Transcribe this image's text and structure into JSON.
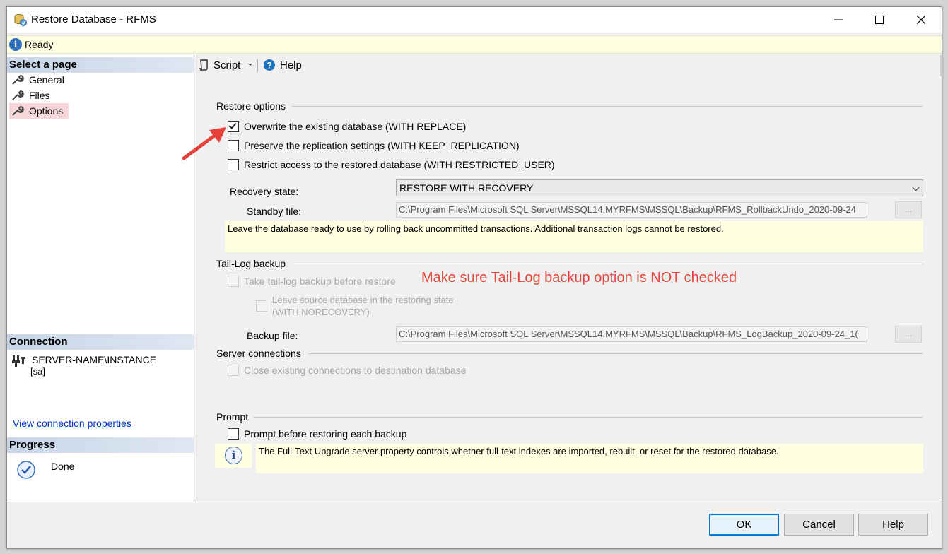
{
  "window": {
    "title": "Restore Database - RFMS",
    "status": "Ready"
  },
  "left_pane": {
    "select_page_header": "Select a page",
    "pages": [
      {
        "label": "General",
        "active": false
      },
      {
        "label": "Files",
        "active": false
      },
      {
        "label": "Options",
        "active": true
      }
    ],
    "connection_header": "Connection",
    "connection_server": "SERVER-NAME\\INSTANCE",
    "connection_user": "[sa]",
    "connection_link": "View connection properties",
    "progress_header": "Progress",
    "progress_status": "Done"
  },
  "toolbar": {
    "script_label": "Script",
    "help_label": "Help"
  },
  "restore_options": {
    "group_label": "Restore options",
    "overwrite": {
      "label": "Overwrite the existing database (WITH REPLACE)",
      "checked": true
    },
    "preserve_replication": {
      "label": "Preserve the replication settings (WITH KEEP_REPLICATION)",
      "checked": false
    },
    "restrict_access": {
      "label": "Restrict access to the restored database (WITH RESTRICTED_USER)",
      "checked": false
    },
    "recovery_state_label": "Recovery state:",
    "recovery_state_value": "RESTORE WITH RECOVERY",
    "standby_file_label": "Standby file:",
    "standby_file_value": "C:\\Program Files\\Microsoft SQL Server\\MSSQL14.MYRFMS\\MSSQL\\Backup\\RFMS_RollbackUndo_2020-09-24",
    "browse_label": "...",
    "recovery_description": "Leave the database ready to use by rolling back uncommitted transactions. Additional transaction logs cannot be restored."
  },
  "tail_log": {
    "group_label": "Tail-Log backup",
    "take_backup": {
      "label": "Take tail-log backup before restore",
      "checked": false
    },
    "leave_restoring_line1": "Leave source database in the restoring state",
    "leave_restoring_line2": "(WITH NORECOVERY)",
    "backup_file_label": "Backup file:",
    "backup_file_value": "C:\\Program Files\\Microsoft SQL Server\\MSSQL14.MYRFMS\\MSSQL\\Backup\\RFMS_LogBackup_2020-09-24_1(",
    "browse_label": "..."
  },
  "annotation": "Make sure Tail-Log backup option is NOT checked",
  "server_connections": {
    "group_label": "Server connections",
    "close_connections": {
      "label": "Close existing connections to destination database",
      "checked": false
    }
  },
  "prompt": {
    "group_label": "Prompt",
    "prompt_before": {
      "label": "Prompt before restoring each backup",
      "checked": false
    },
    "fulltext_info": "The Full-Text Upgrade server property controls whether full-text indexes are imported, rebuilt, or reset for the restored database."
  },
  "footer": {
    "ok_label": "OK",
    "cancel_label": "Cancel",
    "help_label": "Help"
  },
  "colors": {
    "annotation": "#e8413a",
    "status_bg": "#ffffe1",
    "active_page_bg": "#f8d7da",
    "link": "#0033cc",
    "default_button_border": "#0078d7"
  }
}
